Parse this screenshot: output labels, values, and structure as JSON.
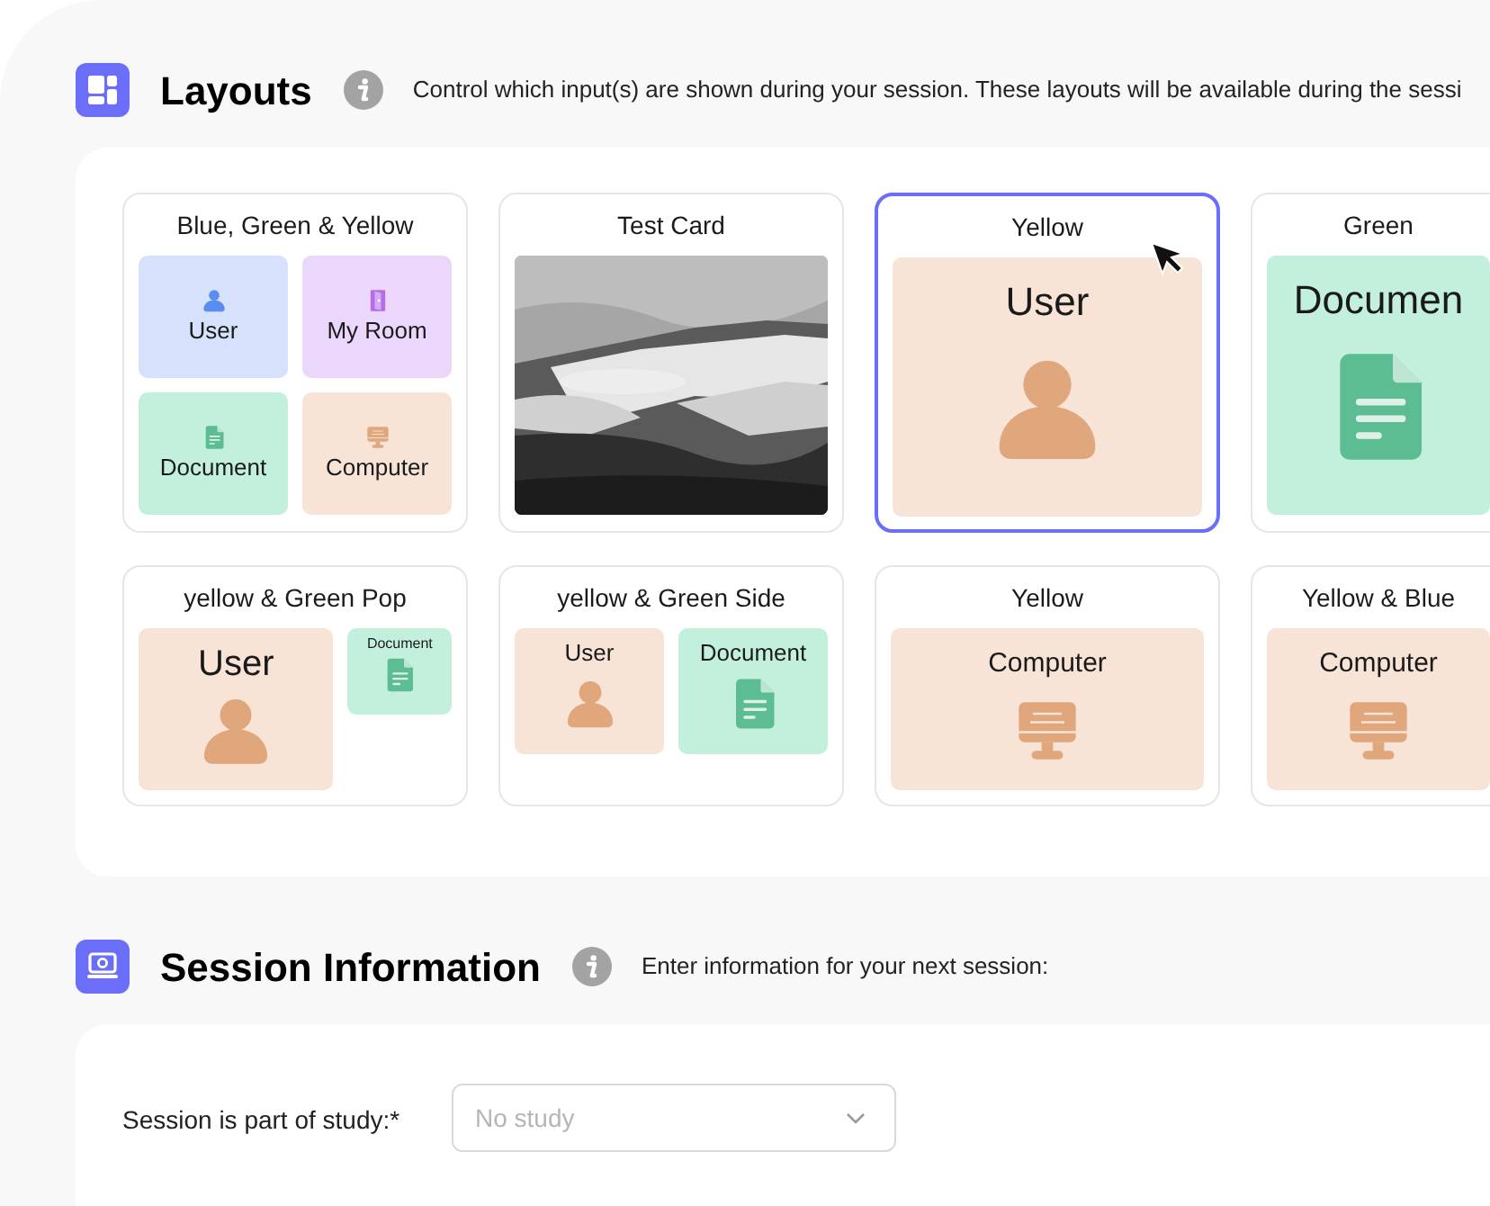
{
  "layouts_section": {
    "title": "Layouts",
    "description": "Control which input(s) are shown during your session. These layouts will be available during the sessi"
  },
  "layouts": [
    {
      "title": "Blue, Green & Yellow",
      "selected": false,
      "kind": "quad",
      "panels": [
        {
          "label": "User",
          "kind": "user",
          "color": "#d6e2fb"
        },
        {
          "label": "My Room",
          "kind": "room",
          "color": "#ead7fb"
        },
        {
          "label": "Document",
          "kind": "document",
          "color": "#c3f0dc"
        },
        {
          "label": "Computer",
          "kind": "computer",
          "color": "#f8e4d7"
        }
      ]
    },
    {
      "title": "Test Card",
      "selected": false,
      "kind": "picture"
    },
    {
      "title": "Yellow",
      "selected": true,
      "kind": "single_large",
      "panels": [
        {
          "label": "User",
          "kind": "user",
          "color": "#f8e4d7"
        }
      ]
    },
    {
      "title": "Green",
      "selected": false,
      "kind": "single_large",
      "panels": [
        {
          "label": "Documen",
          "kind": "document",
          "color": "#c3f0dc"
        }
      ]
    },
    {
      "title": "yellow & Green Pop",
      "selected": false,
      "kind": "pop",
      "panels": [
        {
          "label": "User",
          "kind": "user",
          "color": "#f8e4d7"
        },
        {
          "label": "Document",
          "kind": "document",
          "color": "#c3f0dc"
        }
      ]
    },
    {
      "title": "yellow & Green Side",
      "selected": false,
      "kind": "side",
      "panels": [
        {
          "label": "User",
          "kind": "user",
          "color": "#f8e4d7"
        },
        {
          "label": "Document",
          "kind": "document",
          "color": "#c3f0dc"
        }
      ]
    },
    {
      "title": "Yellow",
      "selected": false,
      "kind": "single",
      "panels": [
        {
          "label": "Computer",
          "kind": "computer",
          "color": "#f8e4d7"
        }
      ]
    },
    {
      "title": "Yellow & Blue",
      "selected": false,
      "kind": "single",
      "panels": [
        {
          "label": "Computer",
          "kind": "computer",
          "color": "#f8e4d7"
        }
      ]
    }
  ],
  "session_section": {
    "title": "Session Information",
    "description": "Enter information for your next session:"
  },
  "study_field": {
    "label": "Session is part of study:*",
    "placeholder": "No study"
  }
}
